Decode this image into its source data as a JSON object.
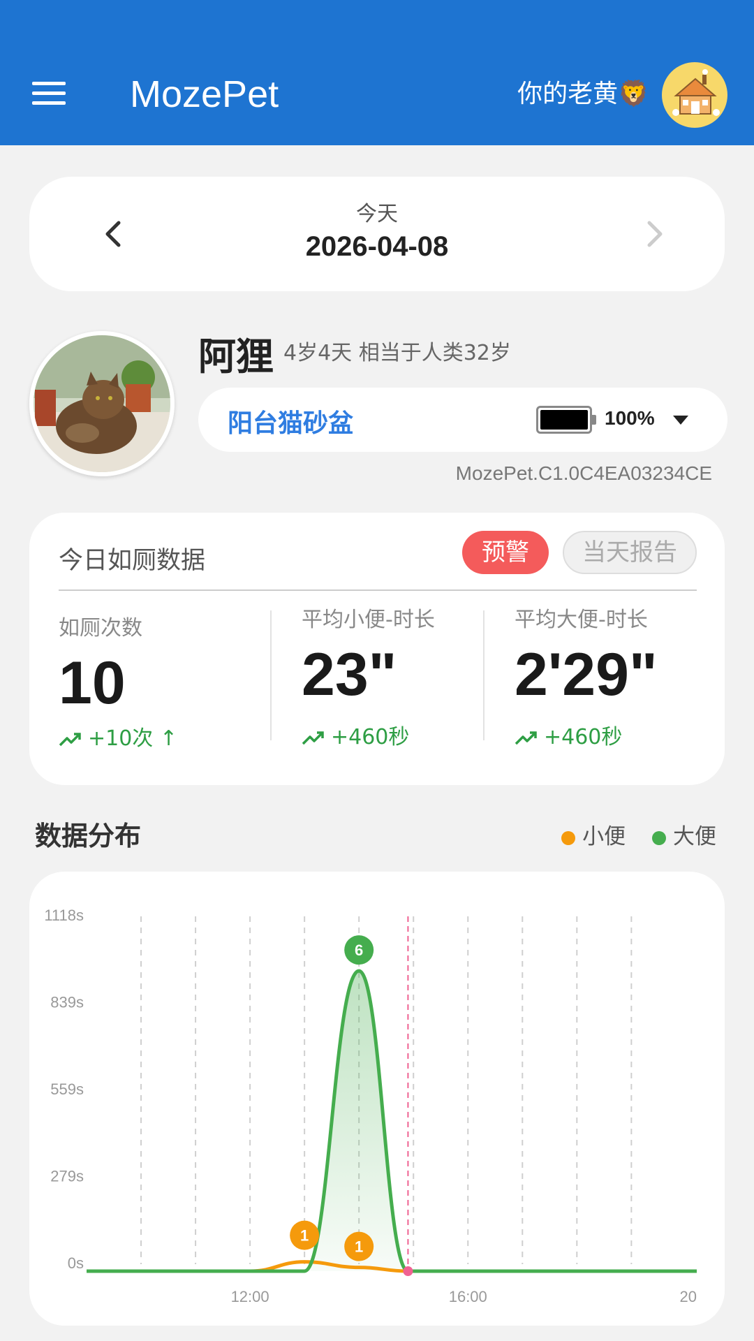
{
  "app": {
    "title": "MozePet",
    "user_name": "你的老黄🦁",
    "menu_icon": "hamburger-icon",
    "avatar_icon": "house-avatar"
  },
  "date_nav": {
    "label": "今天",
    "date": "2026-04-08"
  },
  "pet": {
    "name": "阿狸",
    "age": "4岁4天  相当于人类32岁",
    "device_name": "阳台猫砂盆",
    "battery": "100%",
    "battery_level": 1.0,
    "device_id": "MozePet.C1.0C4EA03234CE"
  },
  "stats": {
    "title": "今日如厕数据",
    "warning_label": "预警",
    "report_label": "当天报告",
    "columns": [
      {
        "label": "如厕次数",
        "value": "10",
        "change": "+10次 ↑"
      },
      {
        "label": "平均小便-时长",
        "value": "23\"",
        "change": "+460秒"
      },
      {
        "label": "平均大便-时长",
        "value": "2'29\"",
        "change": "+460秒"
      }
    ]
  },
  "distribution": {
    "title": "数据分布",
    "legend": [
      {
        "label": "小便",
        "color": "#f59a0c"
      },
      {
        "label": "大便",
        "color": "#45ad4e"
      }
    ]
  },
  "chart_data": {
    "type": "area",
    "y_ticks": [
      "1118s",
      "839s",
      "559s",
      "279s",
      "0s"
    ],
    "ylim": [
      0,
      1118
    ],
    "x_ticks": [
      "12:00",
      "16:00",
      "20"
    ],
    "xlim": [
      9,
      20.2
    ],
    "current_time": 14.9,
    "series": [
      {
        "name": "小便",
        "color": "#f59a0c",
        "points": [
          [
            9,
            0
          ],
          [
            12,
            0
          ],
          [
            13,
            30
          ],
          [
            14,
            12
          ],
          [
            14.9,
            0
          ],
          [
            20.2,
            0
          ]
        ],
        "markers": [
          {
            "x": 13,
            "label": "1"
          },
          {
            "x": 14,
            "label": "1"
          }
        ]
      },
      {
        "name": "大便",
        "color": "#45ad4e",
        "points": [
          [
            9,
            0
          ],
          [
            13,
            0
          ],
          [
            14,
            965
          ],
          [
            14.9,
            0
          ],
          [
            20.2,
            0
          ]
        ],
        "markers": [
          {
            "x": 14,
            "label": "6"
          }
        ]
      }
    ]
  }
}
